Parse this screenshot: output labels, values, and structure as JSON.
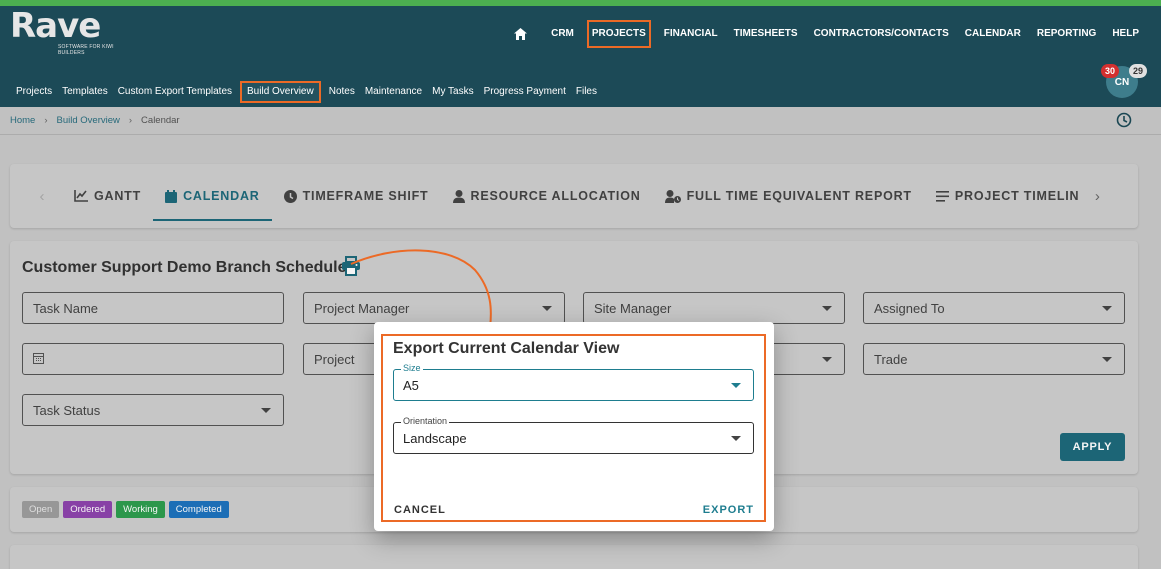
{
  "brand": {
    "name": "Rave",
    "tagline": "SOFTWARE FOR KIWI BUILDERS"
  },
  "colors": {
    "header_bg": "#1c4a57",
    "accent": "#1e6a7b",
    "highlight": "#ec6a26"
  },
  "main_nav": [
    "CRM",
    "PROJECTS",
    "FINANCIAL",
    "TIMESHEETS",
    "CONTRACTORS/CONTACTS",
    "CALENDAR",
    "REPORTING",
    "HELP"
  ],
  "sub_nav": [
    "Projects",
    "Templates",
    "Custom Export Templates",
    "Build Overview",
    "Notes",
    "Maintenance",
    "My Tasks",
    "Progress Payment",
    "Files"
  ],
  "user": {
    "initials": "CN",
    "notifications_red": "30",
    "notifications_grey": "29"
  },
  "breadcrumb": {
    "home": "Home",
    "section": "Build Overview",
    "current": "Calendar"
  },
  "view_tabs": [
    "GANTT",
    "CALENDAR",
    "TIMEFRAME SHIFT",
    "RESOURCE ALLOCATION",
    "FULL TIME EQUIVALENT REPORT",
    "PROJECT TIMELIN"
  ],
  "schedule": {
    "title": "Customer Support Demo Branch Schedule"
  },
  "filters": {
    "task_name": "Task Name",
    "project_manager": "Project Manager",
    "site_manager": "Site Manager",
    "assigned_to": "Assigned To",
    "project": "Project",
    "trade": "Trade",
    "task_status": "Task Status",
    "apply_label": "APPLY"
  },
  "status_legend": [
    {
      "label": "Open",
      "color": "#9e9e9e"
    },
    {
      "label": "Ordered",
      "color": "#8e44ad"
    },
    {
      "label": "Working",
      "color": "#2e9e4f"
    },
    {
      "label": "Completed",
      "color": "#1e73be"
    }
  ],
  "export_dialog": {
    "title": "Export Current Calendar View",
    "size_label": "Size",
    "size_value": "A5",
    "orientation_label": "Orientation",
    "orientation_value": "Landscape",
    "cancel_label": "CANCEL",
    "export_label": "EXPORT"
  }
}
